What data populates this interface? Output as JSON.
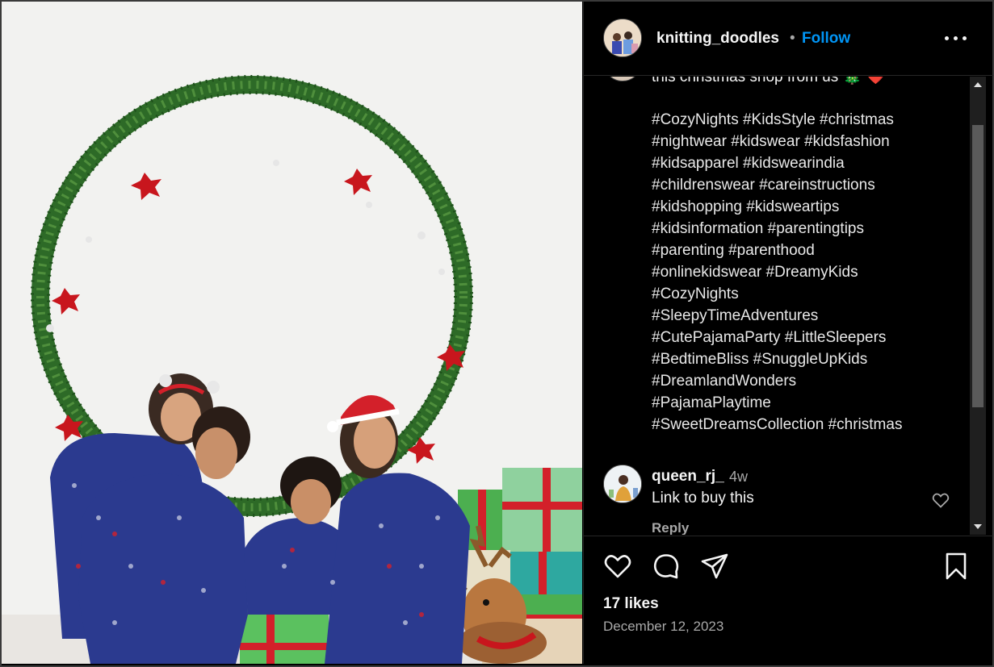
{
  "post": {
    "username": "knitting_doodles",
    "separator": "•",
    "follow_label": "Follow",
    "more_icon": "more-horizontal-icon",
    "caption_partial": "this christmas shop from us 🎄 ❤️",
    "hashtag_lines": [
      "#CozyNights #KidsStyle #christmas",
      "#nightwear #kidswear #kidsfashion",
      "#kidsapparel #kidswearindia",
      "#childrenswear #careinstructions",
      "#kidshopping #kidsweartips",
      "#kidsinformation #parentingtips",
      "#parenting #parenthood",
      "#onlinekidswear #DreamyKids",
      "#CozyNights",
      "#SleepyTimeAdventures",
      "#CutePajamaParty #LittleSleepers",
      "#BedtimeBliss #SnuggleUpKids",
      "#DreamlandWonders",
      "#PajamaPlaytime",
      "#SweetDreamsCollection #christmas"
    ],
    "likes": "17 likes",
    "date": "December 12, 2023"
  },
  "comment": {
    "username": "queen_rj_",
    "time": "4w",
    "text": "Link to buy this",
    "reply_label": "Reply"
  },
  "actions": {
    "like_icon": "heart-icon",
    "comment_icon": "comment-icon",
    "share_icon": "share-icon",
    "save_icon": "bookmark-icon"
  },
  "colors": {
    "background": "#000000",
    "accent": "#0095f6",
    "muted_text": "#a8a8a8",
    "pajama_blue": "#2b3a8f",
    "wreath_green": "#2f6b2a",
    "gift_green": "#4caf50",
    "ribbon_red": "#d3202a"
  }
}
